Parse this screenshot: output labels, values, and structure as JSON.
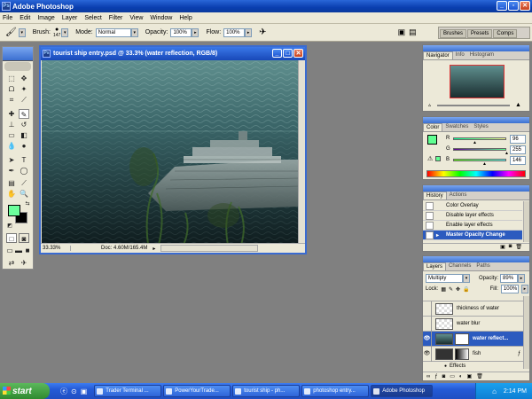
{
  "app": {
    "title": "Adobe Photoshop"
  },
  "menu": [
    "File",
    "Edit",
    "Image",
    "Layer",
    "Select",
    "Filter",
    "View",
    "Window",
    "Help"
  ],
  "options": {
    "brush_label": "Brush:",
    "brush_size": "147",
    "mode_label": "Mode:",
    "mode_value": "Normal",
    "opacity_label": "Opacity:",
    "opacity_value": "100%",
    "flow_label": "Flow:",
    "flow_value": "100%"
  },
  "palette_well": [
    "Brushes",
    "Presets",
    "Comps"
  ],
  "document": {
    "title": "tourist ship entry.psd @ 33.3% (water reflection, RGB/8)",
    "zoom": "33.33%",
    "doc_size": "Doc: 4.60M/165.4M"
  },
  "navigator": {
    "tabs": [
      "Navigator",
      "Info",
      "Histogram"
    ]
  },
  "color": {
    "tabs": [
      "Color",
      "Swatches",
      "Styles"
    ],
    "channels": [
      {
        "label": "R",
        "value": "96",
        "fraction": 0.38
      },
      {
        "label": "G",
        "value": "255",
        "fraction": 1.0
      },
      {
        "label": "B",
        "value": "146",
        "fraction": 0.57
      }
    ],
    "fg_color": "#60ff92"
  },
  "history": {
    "tabs": [
      "History",
      "Actions"
    ],
    "items": [
      "Color Overlay",
      "Disable layer effects",
      "Enable layer effects",
      "Master Opacity Change"
    ],
    "selected_index": 3
  },
  "layers": {
    "tabs": [
      "Layers",
      "Channels",
      "Paths"
    ],
    "blend_mode": "Multiply",
    "opacity_label": "Opacity:",
    "opacity_value": "89%",
    "lock_label": "Lock:",
    "fill_label": "Fill:",
    "fill_value": "100%",
    "items": [
      {
        "name": "thickness of water",
        "visible": false,
        "selected": false
      },
      {
        "name": "water blur",
        "visible": false,
        "selected": false
      },
      {
        "name": "water reflect...",
        "visible": true,
        "selected": true
      },
      {
        "name": "fish",
        "visible": true,
        "selected": false
      }
    ],
    "effects_label": "Effects"
  },
  "taskbar": {
    "start_label": "start",
    "tasks": [
      "Trader Terminal ...",
      "PowerYourTrade...",
      "tourist ship - ph...",
      "photoshop entry...",
      "Adobe Photoshop"
    ],
    "active_index": 4,
    "clock": "2:14 PM"
  }
}
